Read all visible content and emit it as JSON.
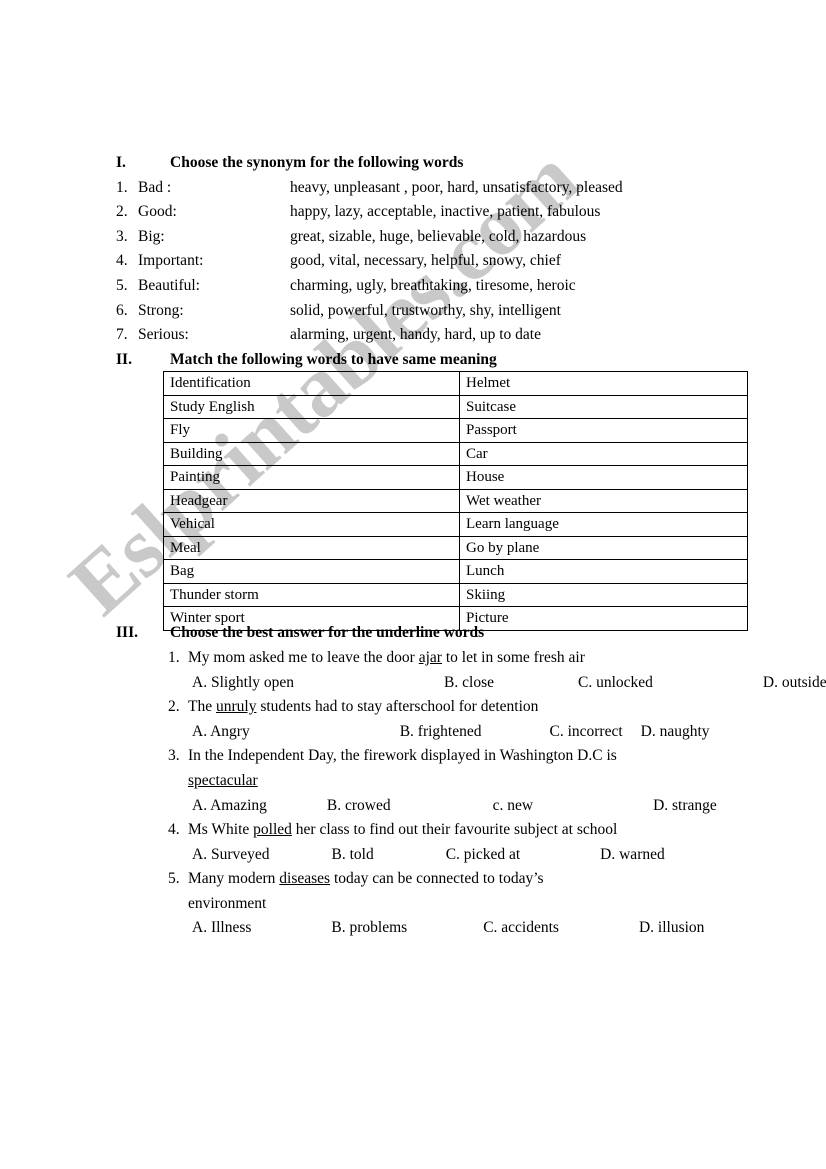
{
  "watermark": {
    "text": "Eslprintables.com",
    "color": "#c9c9c9"
  },
  "section1": {
    "roman": "I.",
    "title": "Choose  the synonym for the following words",
    "rows": [
      {
        "num": "1.",
        "word": "Bad :",
        "options": "heavy, unpleasant , poor, hard, unsatisfactory, pleased"
      },
      {
        "num": "2.",
        "word": "Good:",
        "options": "happy, lazy, acceptable, inactive, patient, fabulous"
      },
      {
        "num": "3.",
        "word": "Big:",
        "options": "great, sizable, huge, believable, cold, hazardous"
      },
      {
        "num": "4.",
        "word": "Important:",
        "options": "good, vital, necessary, helpful, snowy, chief"
      },
      {
        "num": "5.",
        "word": "Beautiful:",
        "options": "charming, ugly, breathtaking, tiresome, heroic"
      },
      {
        "num": "6.",
        "word": "Strong:",
        "options": "solid, powerful, trustworthy, shy, intelligent"
      },
      {
        "num": "7.",
        "word": "Serious:",
        "options": "alarming, urgent, handy, hard, up to date"
      }
    ]
  },
  "section2": {
    "roman": "II.",
    "title": "Match the following words to have same meaning",
    "rows": [
      {
        "left": "Identification",
        "right": "Helmet"
      },
      {
        "left": "Study English",
        "right": "Suitcase"
      },
      {
        "left": "Fly",
        "right": "Passport"
      },
      {
        "left": "Building",
        "right": "Car"
      },
      {
        "left": "Painting",
        "right": "House"
      },
      {
        "left": "Headgear",
        "right": "Wet weather"
      },
      {
        "left": "Vehical",
        "right": "Learn language"
      },
      {
        "left": "Meal",
        "right": "Go by plane"
      },
      {
        "left": "Bag",
        "right": "Lunch"
      },
      {
        "left": "Thunder storm",
        "right": "Skiing"
      },
      {
        "left": "Winter sport",
        "right": "Picture"
      }
    ]
  },
  "section3": {
    "roman": "III.",
    "title": "Choose the best answer for the underline words",
    "questions": [
      {
        "num": "1.",
        "pre": "My mom asked me to leave the door ",
        "underlined": "ajar",
        "post": " to let in some fresh air",
        "cont": "",
        "options": [
          "A. Slightly open",
          "B. close",
          "C. unlocked",
          "D. outside"
        ],
        "offsets": [
          0,
          150,
          84,
          110
        ]
      },
      {
        "num": "2.",
        "pre": "The ",
        "underlined": "unruly",
        "post": " students had to stay afterschool for detention",
        "cont": "",
        "options": [
          "A. Angry",
          "B. frightened",
          "C. incorrect",
          "D. naughty"
        ],
        "offsets": [
          0,
          150,
          68,
          18
        ]
      },
      {
        "num": "3.",
        "pre": "In the Independent Day, the firework displayed  in Washington D.C is",
        "underlined": "",
        "post": "",
        "cont": "spectacular",
        "cont_underlined": true,
        "options": [
          "A. Amazing",
          "B. crowed",
          "c. new",
          "D. strange"
        ],
        "offsets": [
          0,
          60,
          102,
          120
        ]
      },
      {
        "num": "4.",
        "pre": "Ms White ",
        "underlined": "polled",
        "post": " her class to find out their favourite subject at  school",
        "cont": "",
        "options": [
          "A. Surveyed",
          "B. told",
          "C. picked at",
          "D. warned"
        ],
        "offsets": [
          0,
          62,
          72,
          80
        ]
      },
      {
        "num": "5.",
        "pre": "Many modern ",
        "underlined": "diseases",
        "post": " today can be connected to today’s",
        "cont": "environment",
        "cont_underlined": false,
        "options": [
          "A. Illness",
          "B. problems",
          "C. accidents",
          "D. illusion"
        ],
        "offsets": [
          0,
          80,
          76,
          80
        ]
      }
    ]
  }
}
